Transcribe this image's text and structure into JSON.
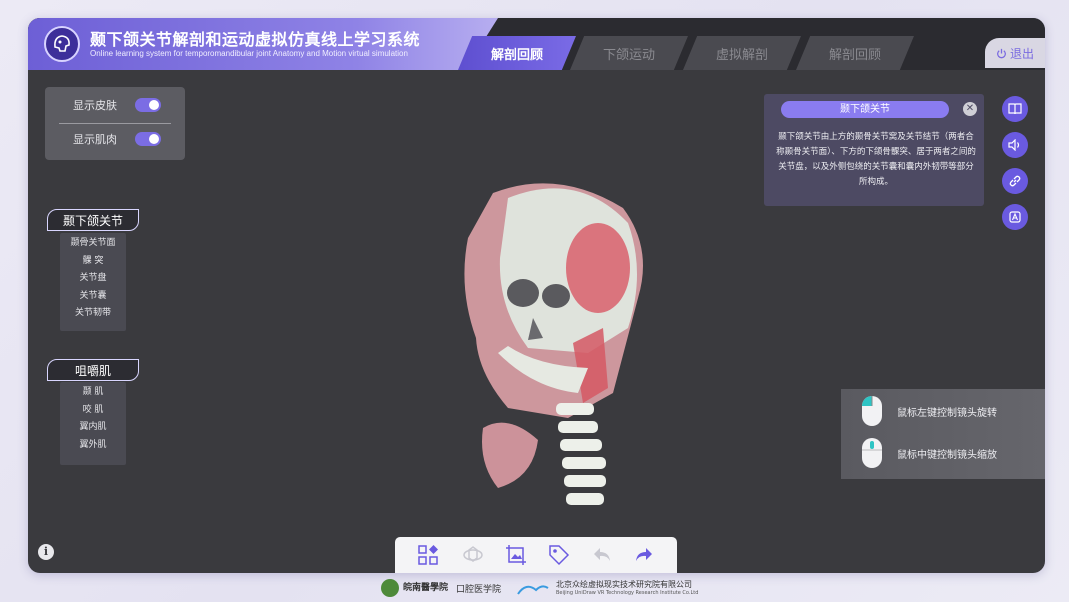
{
  "header": {
    "title_cn": "颞下颌关节解剖和运动虚拟仿真线上学习系统",
    "title_en": "Online learning system for temporomandibular joint Anatomy and Motion virtual simulation",
    "tabs": [
      {
        "label": "解剖回顾",
        "active": true
      },
      {
        "label": "下颌运动",
        "active": false
      },
      {
        "label": "虚拟解剖",
        "active": false
      },
      {
        "label": "解剖回顾",
        "active": false
      }
    ],
    "logout_label": "退出"
  },
  "toggles": [
    {
      "label": "显示皮肤",
      "on": true
    },
    {
      "label": "显示肌肉",
      "on": true
    }
  ],
  "menus": [
    {
      "title": "颞下颌关节",
      "items": [
        "颞骨关节面",
        "髁 突",
        "关节盘",
        "关节囊",
        "关节韧带"
      ]
    },
    {
      "title": "咀嚼肌",
      "items": [
        "颞 肌",
        "咬 肌",
        "翼内肌",
        "翼外肌"
      ]
    }
  ],
  "info_card": {
    "title": "颞下颌关节",
    "body": "颞下颌关节由上方的颞骨关节窝及关节结节（两者合称颞骨关节面）、下方的下颌骨髁突、居于两者之间的关节盘，以及外侧包绕的关节囊和囊内外韧带等部分所构成。"
  },
  "right_buttons": [
    "book-icon",
    "speaker-icon",
    "link-icon",
    "ai-icon"
  ],
  "hints": [
    {
      "text": "鼠标左键控制镜头旋转",
      "icon": "mouse-left-icon"
    },
    {
      "text": "鼠标中键控制镜头缩放",
      "icon": "mouse-middle-icon"
    }
  ],
  "toolbar": [
    "components-icon",
    "rotate-icon",
    "screenshot-icon",
    "tag-icon",
    "undo-icon",
    "redo-icon"
  ],
  "colors": {
    "accent": "#6a5ae0",
    "panel": "#3a3a3e",
    "header": "#2b2b30"
  },
  "footer": {
    "school_name": "皖南醫學院",
    "school_dept": "口腔医学院",
    "company_cn": "北京众绘虚拟现实技术研究院有限公司",
    "company_en": "Beijing UniDraw VR Technology Research Institute Co.Ltd"
  }
}
